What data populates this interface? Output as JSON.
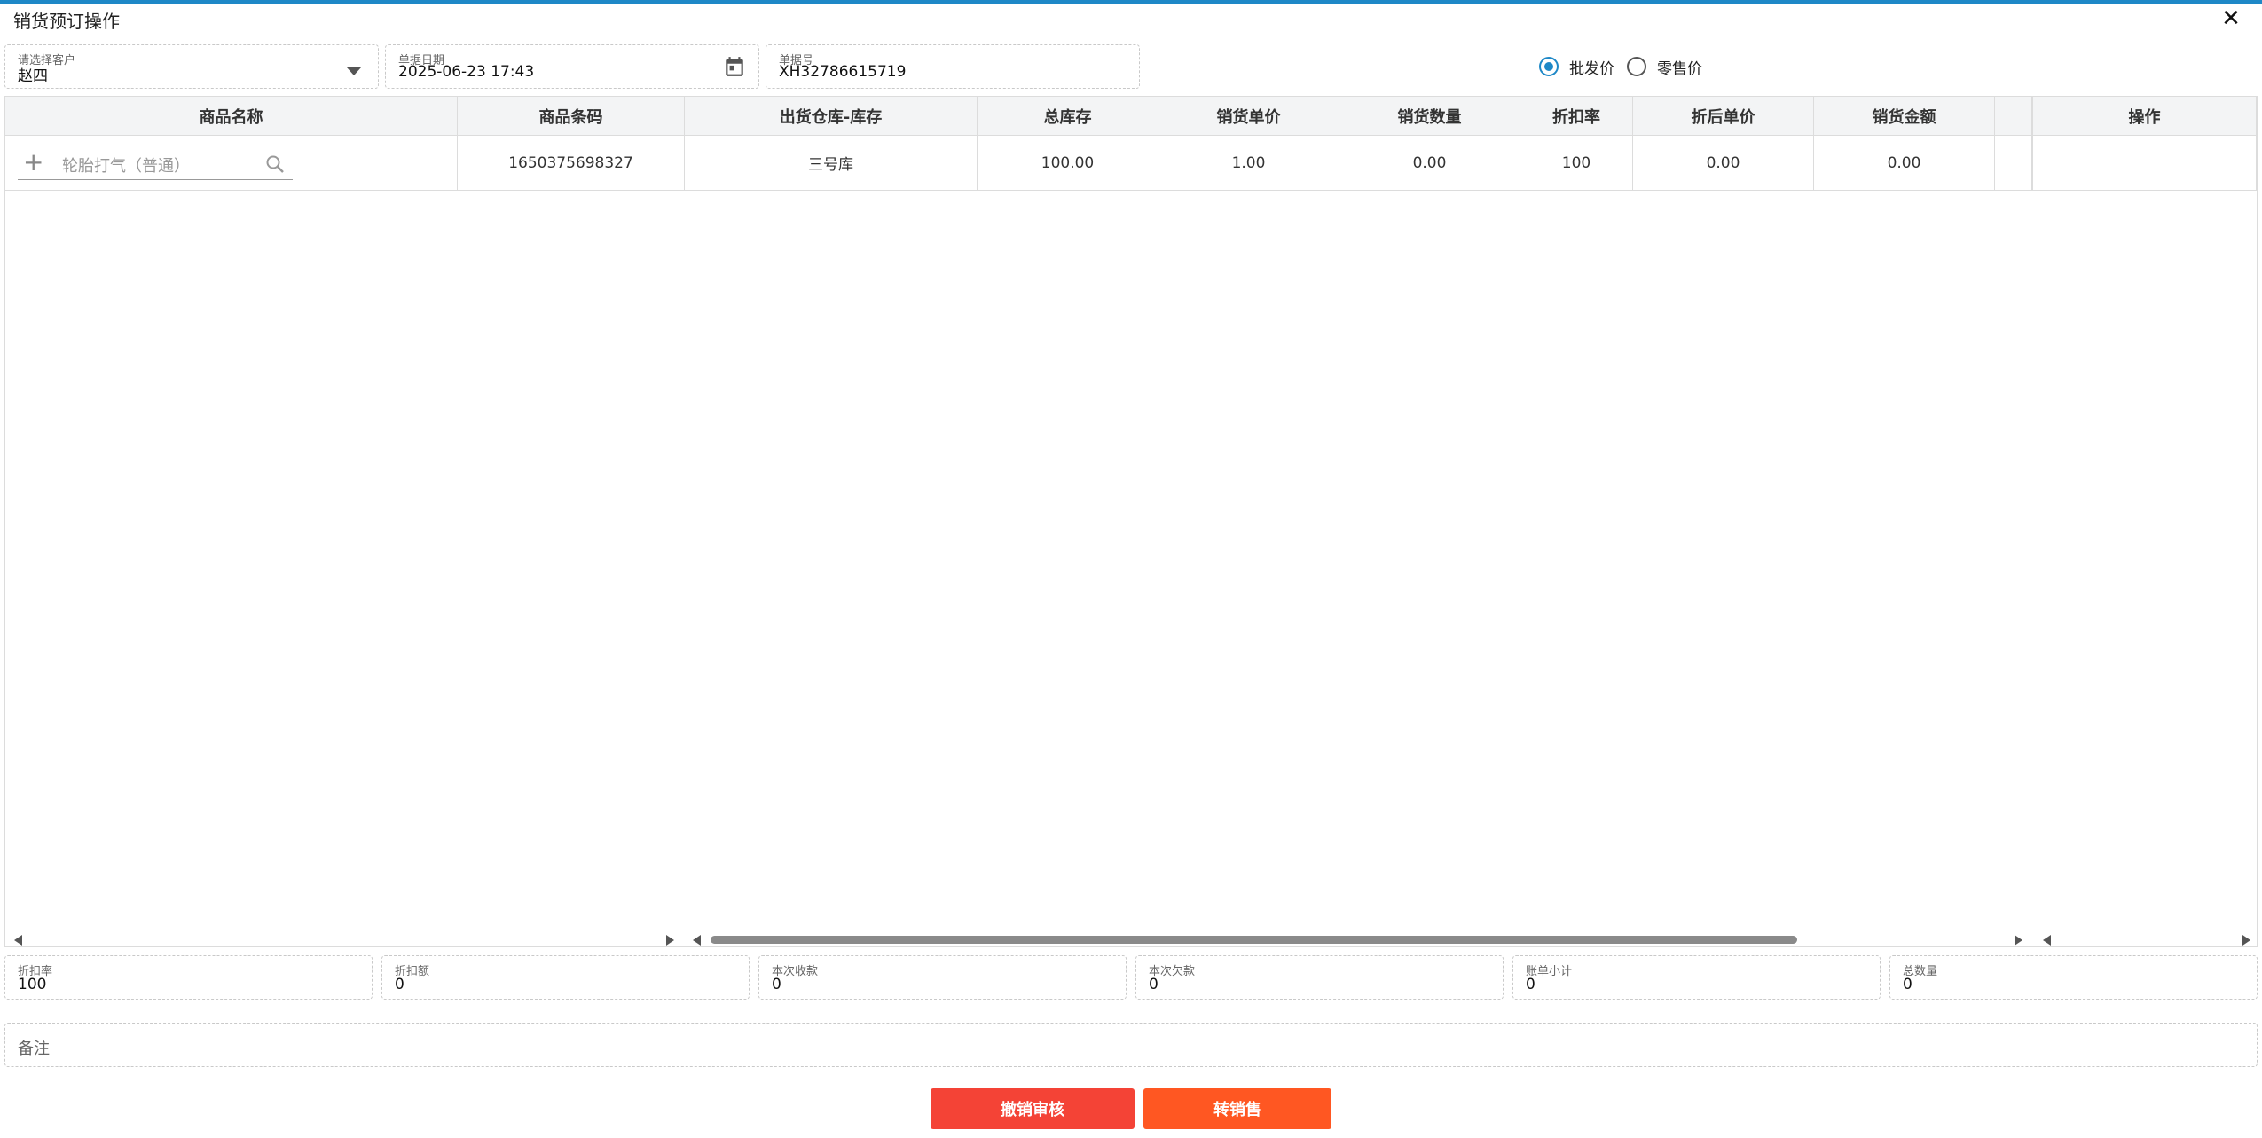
{
  "window": {
    "title": "销货预订操作",
    "close_icon": "close-icon"
  },
  "header": {
    "customer": {
      "label": "请选择客户",
      "value": "赵四",
      "icon": "dropdown-arrow-icon"
    },
    "date": {
      "label": "单据日期",
      "value": "2025-06-23 17:43",
      "icon": "calendar-icon"
    },
    "doc_no": {
      "label": "单据号",
      "value": "XH32786615719"
    },
    "price_type": {
      "options": [
        "批发价",
        "零售价"
      ],
      "selected": "批发价"
    }
  },
  "table": {
    "columns": [
      "商品名称",
      "商品条码",
      "出货仓库-库存",
      "总库存",
      "销货单价",
      "销货数量",
      "折扣率",
      "折后单价",
      "销货金额",
      "",
      "操作"
    ],
    "name_placeholder": "轮胎打气（普通）",
    "row": {
      "barcode": "1650375698327",
      "warehouse": "三号库",
      "total_stock": "100.00",
      "unit_price": "1.00",
      "quantity": "0.00",
      "discount_rate": "100",
      "discounted_price": "0.00",
      "amount": "0.00",
      "extra": "",
      "action": ""
    }
  },
  "summary": {
    "discount_rate": {
      "label": "折扣率",
      "value": "100"
    },
    "discount_amount": {
      "label": "折扣额",
      "value": "0"
    },
    "received": {
      "label": "本次收款",
      "value": "0"
    },
    "owed": {
      "label": "本次欠款",
      "value": "0"
    },
    "subtotal": {
      "label": "账单小计",
      "value": "0"
    },
    "total_qty": {
      "label": "总数量",
      "value": "0"
    }
  },
  "remark": {
    "placeholder": "备注"
  },
  "buttons": {
    "revoke": "撤销审核",
    "to_sale": "转销售"
  },
  "colors": {
    "accent": "#1e88c7",
    "revoke_button": "#f44336",
    "sale_button": "#ff5722"
  }
}
